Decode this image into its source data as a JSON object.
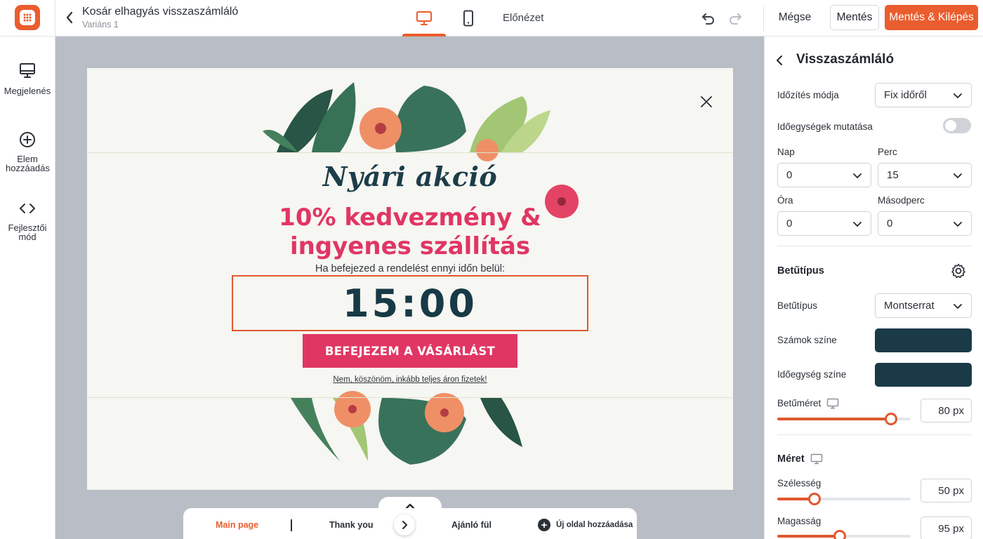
{
  "header": {
    "title": "Kosár elhagyás visszaszámláló",
    "variant": "Variáns 1",
    "preview": "Előnézet",
    "cancel": "Mégse",
    "save": "Mentés",
    "save_exit": "Mentés & Kilépés",
    "active_device": "desktop"
  },
  "sidebar": {
    "items": [
      {
        "label": "Megjelenés",
        "icon": "monitor-icon"
      },
      {
        "label": "Elem hozzáadás",
        "icon": "plus-circle-icon"
      },
      {
        "label": "Fejlesztői mód",
        "icon": "code-icon"
      }
    ]
  },
  "popup": {
    "script_title": "Nyári akció",
    "headline_1": "10% kedvezmény &",
    "headline_2": "ingyenes szállítás",
    "hint": "Ha befejezed a rendelést ennyi időn belül:",
    "timer": "15:00",
    "cta": "BEFEJEZEM A VÁSÁRLÁST",
    "no_thanks": "Nem, köszönöm, inkább teljes áron fizetek!"
  },
  "pages": {
    "tabs": [
      "Main page",
      "Thank you",
      "Ajánló fül"
    ],
    "active": "Main page",
    "add_label": "Új oldal hozzáadása"
  },
  "panel": {
    "title": "Visszaszámláló",
    "timing_mode_label": "Időzítés módja",
    "timing_mode_value": "Fix időről",
    "show_units_label": "Időegységek mutatása",
    "show_units_on": false,
    "day_label": "Nap",
    "day_value": "0",
    "minute_label": "Perc",
    "minute_value": "15",
    "hour_label": "Óra",
    "hour_value": "0",
    "second_label": "Másodperc",
    "second_value": "0",
    "font_section": "Betűtípus",
    "font_label": "Betűtípus",
    "font_value": "Montserrat",
    "numbers_color_label": "Számok színe",
    "numbers_color": "#1a3a47",
    "unit_color_label": "Időegység színe",
    "unit_color": "#1a3a47",
    "font_size_label": "Betűméret",
    "font_size_value": "80 px",
    "font_size_level": 0.85,
    "size_section": "Méret",
    "width_label": "Szélesség",
    "width_value": "50 px",
    "width_level": 0.28,
    "height_label": "Magasság",
    "height_value": "95 px",
    "height_level": 0.47
  },
  "colors": {
    "accent": "#ea5d2e",
    "pink": "#e03663",
    "dark_teal": "#173a46",
    "canvas_bg": "#b9bdc5"
  }
}
